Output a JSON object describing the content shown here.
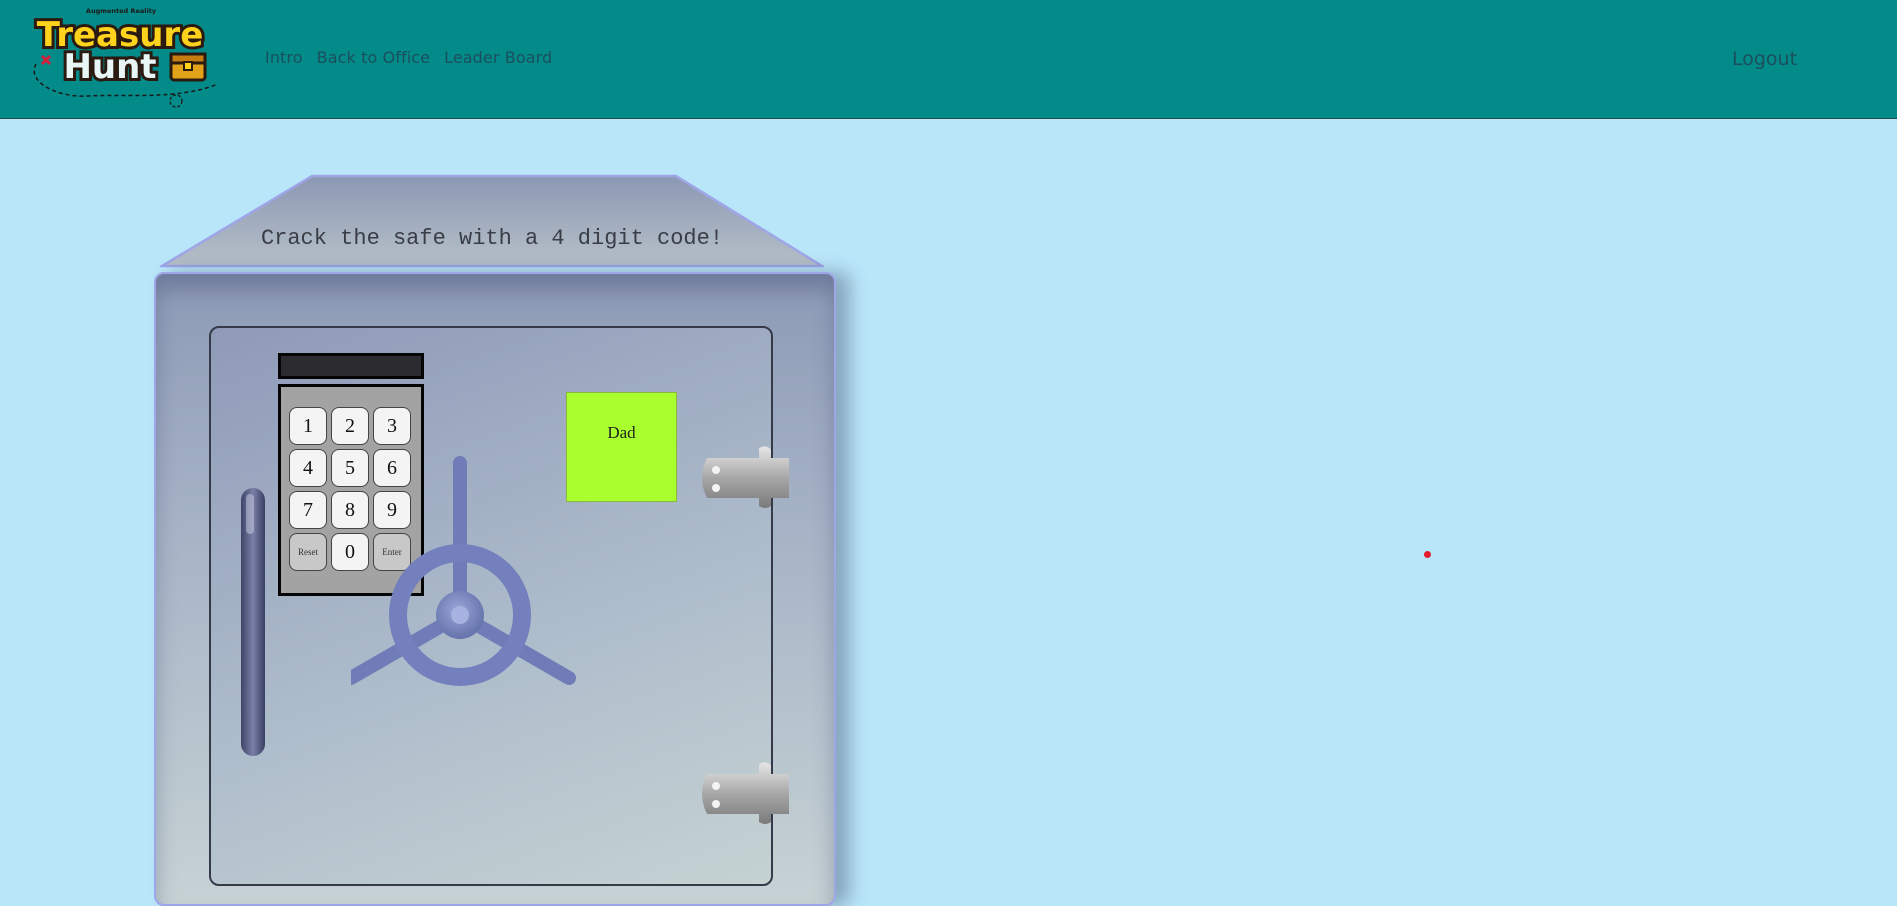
{
  "header": {
    "logo": {
      "tagline": "Augmented Reality",
      "line1": "Treasure",
      "line2": "Hunt"
    },
    "nav": [
      "Intro",
      "Back to Office",
      "Leader Board"
    ],
    "logout": "Logout"
  },
  "safe": {
    "title": "Crack the safe with a 4 digit code!",
    "display_value": "",
    "keys": [
      "1",
      "2",
      "3",
      "4",
      "5",
      "6",
      "7",
      "8",
      "9",
      "Reset",
      "0",
      "Enter"
    ],
    "note": "Dad"
  },
  "colors": {
    "header_bg": "#028b89",
    "page_bg": "#bae6fa",
    "note_bg": "#a9ff2d",
    "marker": "#e31b2b"
  }
}
